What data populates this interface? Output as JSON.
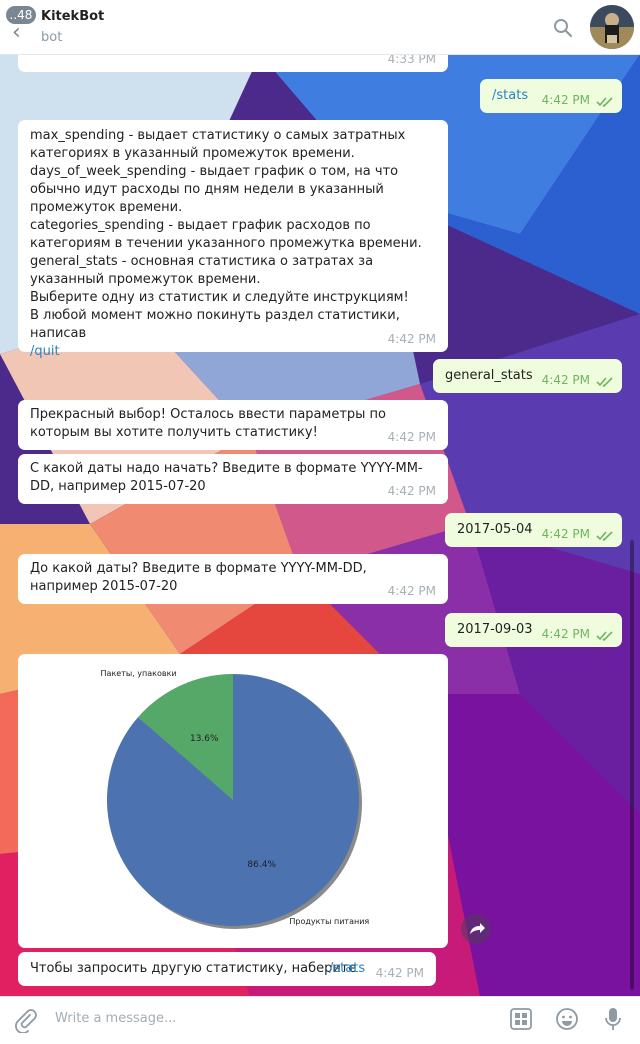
{
  "header": {
    "back_count": "..48",
    "title": "KitekBot",
    "subtitle": "bot"
  },
  "messages": [
    {
      "id": "m0",
      "dir": "in",
      "time": "4:33 PM",
      "text": ""
    },
    {
      "id": "m1",
      "dir": "out",
      "text": "/stats",
      "time": "4:42 PM",
      "link": true
    },
    {
      "id": "m2",
      "dir": "in",
      "time": "4:42 PM",
      "text": "max_spending - выдает статистику о самых затратных категориях в указанный промежуток времени.\ndays_of_week_spending - выдает график о том, на что обычно идут расходы по дням недели в указанный промежуток времени.\ncategories_spending - выдает график расходов по категориям в течении указанного промежутка времени.\ngeneral_stats - основная статистика о затратах за указанный промежуток времени.\nВыберите одну из статистик и следуйте инструкциям!\nВ любой момент можно покинуть раздел статистики, написав",
      "link_text": "/quit"
    },
    {
      "id": "m3",
      "dir": "out",
      "text": "general_stats",
      "time": "4:42 PM"
    },
    {
      "id": "m4",
      "dir": "in",
      "time": "4:42 PM",
      "text": "Прекрасный выбор! Осталось ввести параметры по которым вы хотите получить статистику!"
    },
    {
      "id": "m5",
      "dir": "in",
      "time": "4:42 PM",
      "text": "С какой даты надо начать? Введите в формате YYYY-MM-DD, например 2015-07-20"
    },
    {
      "id": "m6",
      "dir": "out",
      "text": "2017-05-04",
      "time": "4:42 PM"
    },
    {
      "id": "m7",
      "dir": "in",
      "time": "4:42 PM",
      "text": "До какой даты? Введите в формате YYYY-MM-DD, например 2015-07-20"
    },
    {
      "id": "m8",
      "dir": "out",
      "text": "2017-09-03",
      "time": "4:42 PM"
    },
    {
      "id": "m9",
      "dir": "in",
      "time": "4:42 PM",
      "text": "Чтобы запросить другую статистику, наберите",
      "link_text": "/stats"
    }
  ],
  "chart_data": {
    "type": "pie",
    "slices": [
      {
        "label": "Продукты питания",
        "value": 86.4,
        "pct_label": "86.4%",
        "color": "#4c72b0"
      },
      {
        "label": "Пакеты, упаковки",
        "value": 13.6,
        "pct_label": "13.6%",
        "color": "#55a868"
      }
    ]
  },
  "composer": {
    "placeholder": "Write a message..."
  }
}
